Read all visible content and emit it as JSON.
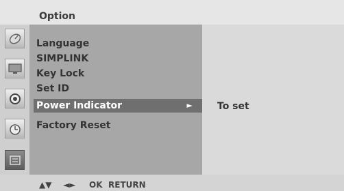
{
  "header": {
    "title": "Option"
  },
  "sidebar": {
    "items": [
      {
        "icon": "satellite-dish-icon",
        "active": false
      },
      {
        "icon": "tv-screen-icon",
        "active": false
      },
      {
        "icon": "speaker-icon",
        "active": false
      },
      {
        "icon": "clock-icon",
        "active": false
      },
      {
        "icon": "option-box-icon",
        "active": true
      }
    ]
  },
  "menu": {
    "items": [
      {
        "label": "Language"
      },
      {
        "label": "SIMPLINK"
      },
      {
        "label": "Key Lock"
      },
      {
        "label": "Set ID"
      },
      {
        "label": "Power Indicator",
        "selected": true,
        "arrow": "►"
      },
      {
        "label": "Factory Reset"
      }
    ]
  },
  "submenu": {
    "value": "To set"
  },
  "footer": {
    "updown": "▲▼",
    "leftright": "◄►",
    "ok": "OK",
    "return": "RETURN"
  },
  "colors": {
    "menu_bg": "#a7a7a7",
    "selected_bg": "#6f6f6f",
    "subpanel_bg": "#dadada"
  }
}
